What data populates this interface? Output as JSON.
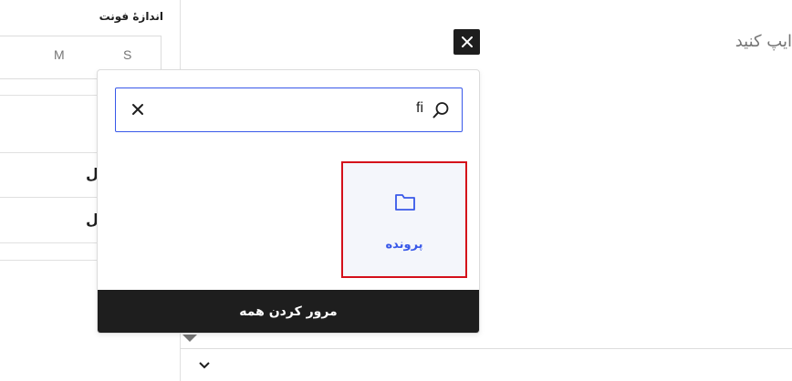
{
  "sidebar": {
    "font_size_label": "اندازهٔ فونت",
    "size_options": [
      "S",
      "M"
    ],
    "row_fragments": [
      "ل",
      "ل"
    ]
  },
  "editor": {
    "placeholder": "ایپ کنید"
  },
  "inserter": {
    "search_value": "fi",
    "result_label": "پرونده",
    "browse_all_label": "مرور کردن همه"
  },
  "icons": {
    "close": "close-icon",
    "search": "search-icon",
    "clear": "clear-icon",
    "folder": "folder-icon",
    "chevron": "chevron-down-icon"
  },
  "colors": {
    "accent": "#3858e9",
    "highlight": "#d40f1a",
    "dark": "#1e1e1e"
  }
}
